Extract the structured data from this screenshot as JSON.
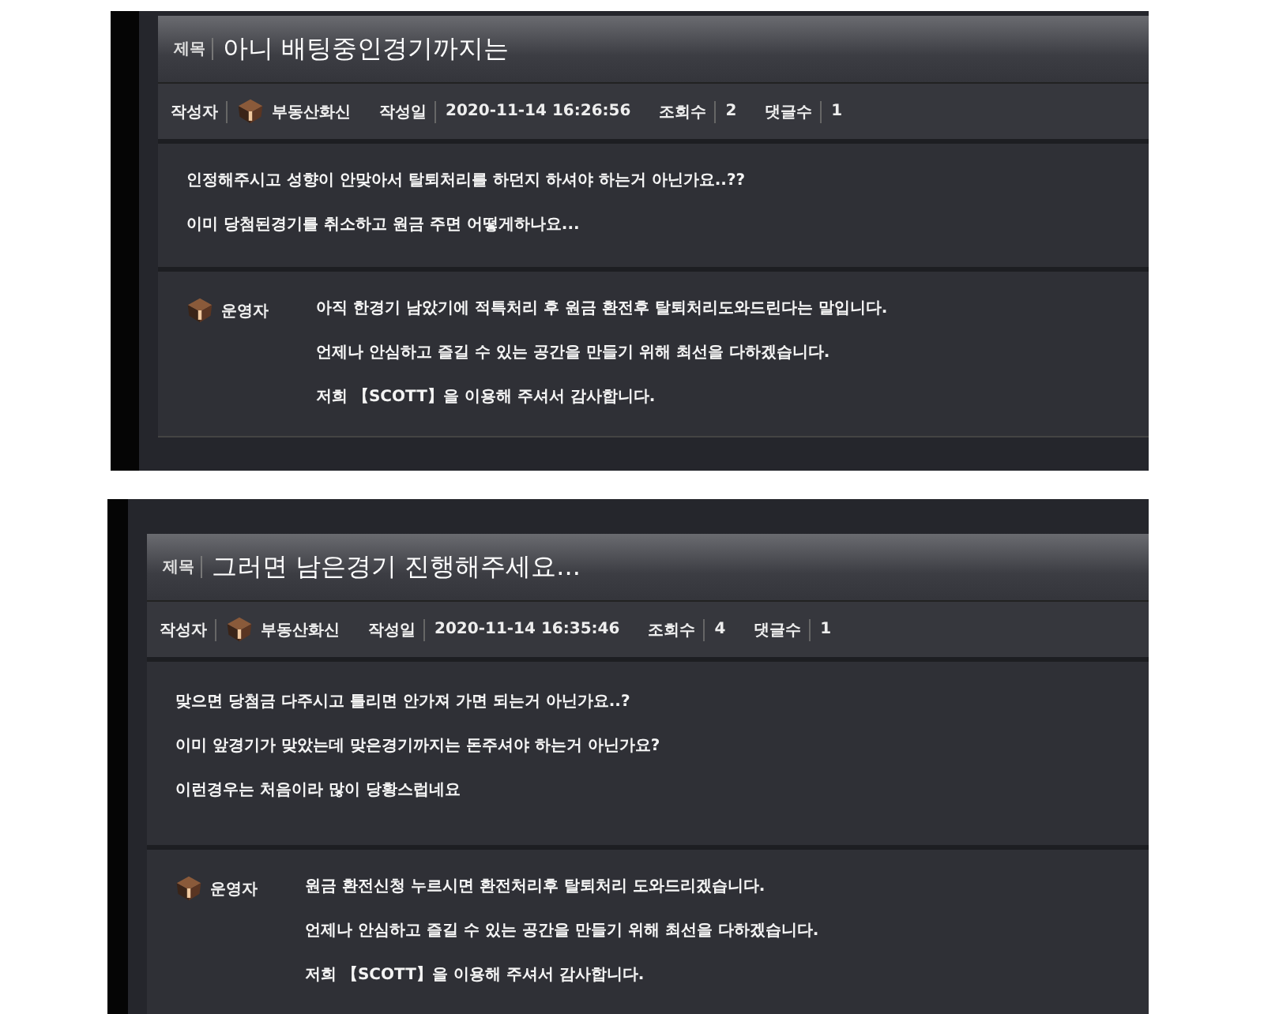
{
  "posts": [
    {
      "subject_label": "제목",
      "title": "아니 배팅중인경기까지는",
      "meta": [
        {
          "label": "작성자",
          "value": "부동산화신",
          "kind": "author"
        },
        {
          "label": "작성일",
          "value": "2020-11-14 16:26:56",
          "kind": "text"
        },
        {
          "label": "조회수",
          "value": "2",
          "kind": "text"
        },
        {
          "label": "댓글수",
          "value": "1",
          "kind": "text"
        }
      ],
      "body": [
        "인정해주시고 성향이 안맞아서 탈퇴처리를 하던지 하셔야 하는거 아닌가요..??",
        "이미 당첨된경기를 취소하고 원금 주면 어떻게하나요..."
      ],
      "reply": {
        "name": "운영자",
        "lines": [
          "아직 한경기 남았기에 적특처리 후 원금 환전후 탈퇴처리도와드린다는 말입니다.",
          "언제나 안심하고 즐길 수 있는 공간을 만들기 위해 최선을 다하겠습니다.",
          "저희 【SCOTT】을 이용해 주셔서 감사합니다."
        ]
      }
    },
    {
      "subject_label": "제목",
      "title": "그러면 남은경기 진행해주세요...",
      "meta": [
        {
          "label": "작성자",
          "value": "부동산화신",
          "kind": "author"
        },
        {
          "label": "작성일",
          "value": "2020-11-14 16:35:46",
          "kind": "text"
        },
        {
          "label": "조회수",
          "value": "4",
          "kind": "text"
        },
        {
          "label": "댓글수",
          "value": "1",
          "kind": "text"
        }
      ],
      "body": [
        "맞으면 당첨금 다주시고 틀리면 안가져 가면 되는거 아닌가요..?",
        "이미 앞경기가 맞았는데 맞은경기까지는 돈주셔야 하는거 아닌가요?",
        "이런경우는 처음이라 많이 당황스럽네요"
      ],
      "reply": {
        "name": "운영자",
        "lines": [
          "원금 환전신청 누르시면 환전처리후 탈퇴처리 도와드리겠습니다.",
          "언제나 안심하고 즐길 수 있는 공간을 만들기 위해 최선을 다하겠습니다.",
          "저희 【SCOTT】을 이용해 주셔서 감사합니다."
        ]
      }
    }
  ]
}
